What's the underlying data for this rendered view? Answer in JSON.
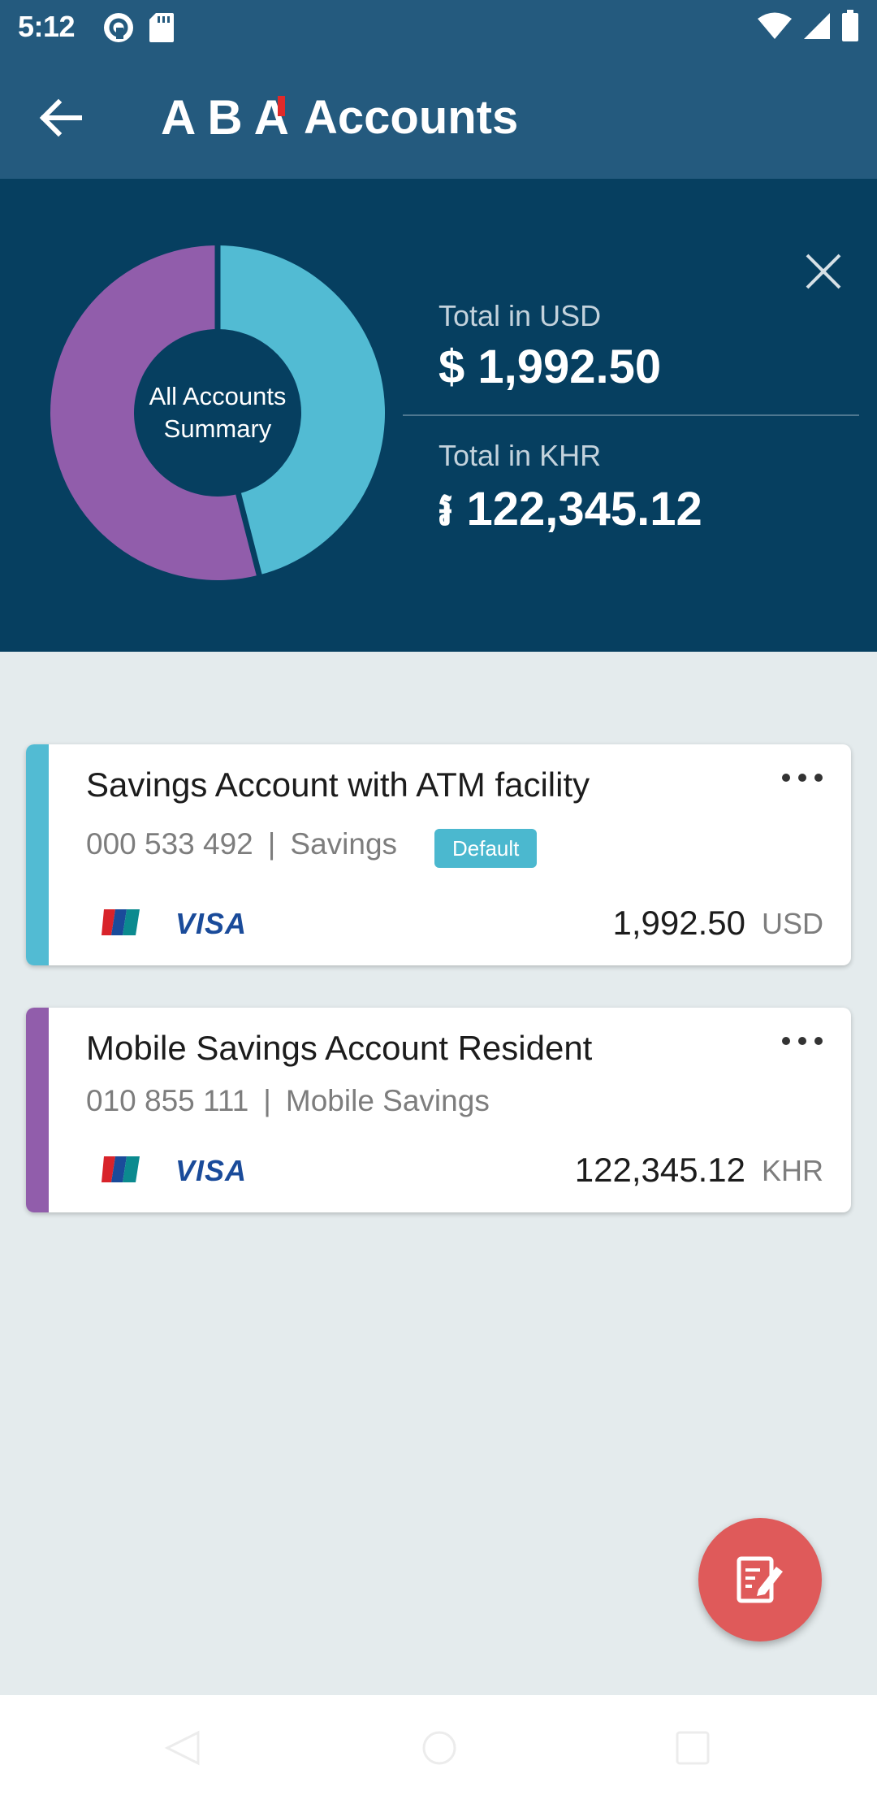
{
  "status_bar": {
    "time": "5:12",
    "icons": [
      "pocket-casts-icon",
      "sd-card-icon",
      "wifi-icon",
      "cellular-signal-icon",
      "battery-icon"
    ]
  },
  "app_bar": {
    "logo_text": "ABA",
    "title": "Accounts",
    "back_icon": "arrow-left-icon"
  },
  "summary": {
    "center_label_line1": "All Accounts",
    "center_label_line2": "Summary",
    "usd": {
      "label": "Total in USD",
      "value": "$ 1,992.50"
    },
    "khr": {
      "label": "Total in KHR",
      "value": "៛ 122,345.12"
    },
    "close_icon": "close-icon",
    "donut_segments": [
      {
        "name": "Savings Account with ATM facility",
        "fraction": 0.46,
        "color": "#52bbd3"
      },
      {
        "name": "Mobile Savings Account Resident",
        "fraction": 0.54,
        "color": "#915dab"
      }
    ]
  },
  "accounts": [
    {
      "title": "Savings Account with ATM facility",
      "number": "000 533 492",
      "type": "Savings",
      "badge": "Default",
      "amount": "1,992.50",
      "currency": "USD",
      "stripe_color": "#52bbd3",
      "card_brands": [
        "UnionPay",
        "VISA"
      ]
    },
    {
      "title": "Mobile Savings Account Resident",
      "number": "010 855 111",
      "type": "Mobile Savings",
      "amount": "122,345.12",
      "currency": "KHR",
      "stripe_color": "#915dab",
      "card_brands": [
        "UnionPay",
        "VISA"
      ]
    }
  ],
  "fab": {
    "icon": "edit-note-icon",
    "color": "#df5a5a"
  },
  "colors": {
    "app_bar": "#245a7e",
    "summary_panel": "#063f60",
    "background": "#e4ebed"
  }
}
